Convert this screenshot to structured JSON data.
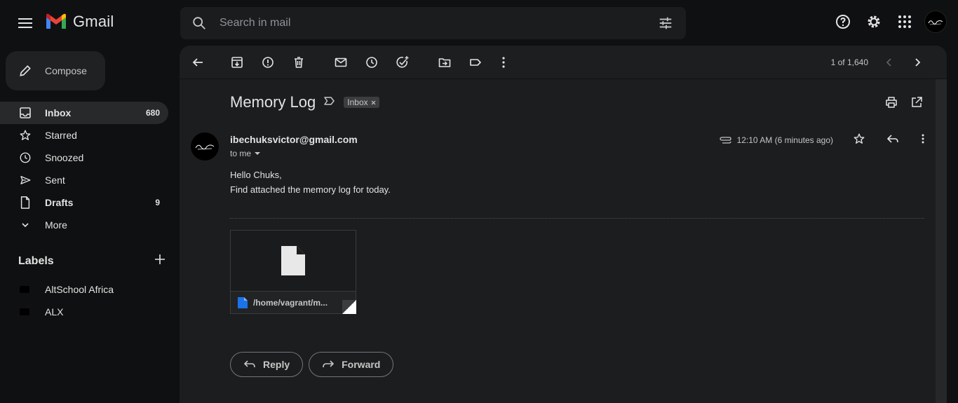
{
  "app": {
    "name": "Gmail"
  },
  "search": {
    "placeholder": "Search in mail"
  },
  "sidebar": {
    "compose_label": "Compose",
    "items": [
      {
        "label": "Inbox",
        "count": "680",
        "icon": "inbox-icon"
      },
      {
        "label": "Starred",
        "count": "",
        "icon": "star-icon"
      },
      {
        "label": "Snoozed",
        "count": "",
        "icon": "clock-icon"
      },
      {
        "label": "Sent",
        "count": "",
        "icon": "send-icon"
      },
      {
        "label": "Drafts",
        "count": "9",
        "icon": "draft-icon"
      },
      {
        "label": "More",
        "count": "",
        "icon": "chevron-down-icon"
      }
    ],
    "labels_heading": "Labels",
    "labels": [
      {
        "label": "AltSchool Africa",
        "color": "#000000"
      },
      {
        "label": "ALX",
        "color": "#000000"
      }
    ]
  },
  "toolbar": {
    "pager": "1 of 1,640"
  },
  "email": {
    "subject": "Memory Log",
    "tag": "Inbox",
    "sender": "ibechuksvictor@gmail.com",
    "to": "to me",
    "time": "12:10 AM (6 minutes ago)",
    "body_line1": "Hello Chuks,",
    "body_line2": "Find attached the memory log for today.",
    "attachment_name": "/home/vagrant/m..."
  },
  "actions": {
    "reply_label": "Reply",
    "forward_label": "Forward"
  },
  "colors": {
    "background": "#0f1011",
    "panel": "#1c1d1f",
    "active_nav": "#27292b",
    "file_icon": "#1a73e8"
  }
}
